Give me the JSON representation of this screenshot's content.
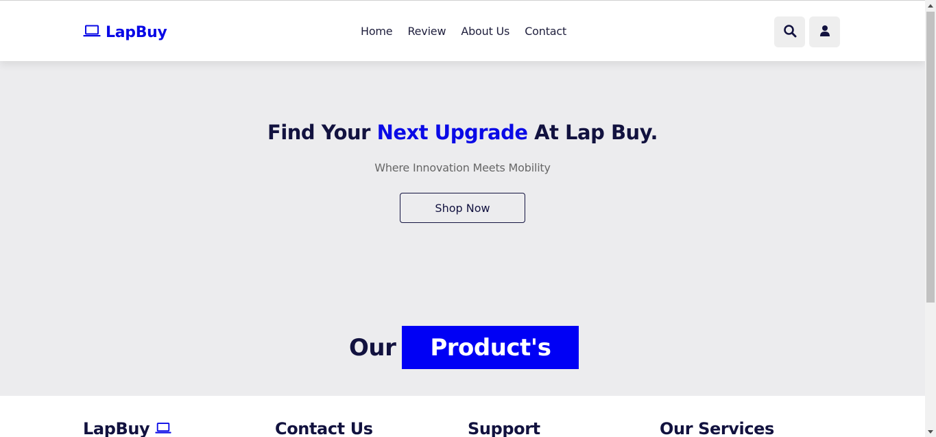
{
  "header": {
    "brand": "LapBuy",
    "brand_icon": "laptop-icon",
    "nav": [
      "Home",
      "Review",
      "About Us",
      "Contact"
    ],
    "search_icon": "search-icon",
    "user_icon": "user-icon"
  },
  "hero": {
    "title_pre": "Find Your ",
    "title_accent": "Next Upgrade",
    "title_post": " At Lap Buy.",
    "subtitle": "Where Innovation Meets Mobility",
    "cta": "Shop Now"
  },
  "products": {
    "heading_plain": "Our",
    "heading_box": "Product's"
  },
  "footer": {
    "columns": [
      "LapBuy",
      "Contact Us",
      "Support",
      "Our Services"
    ]
  },
  "colors": {
    "accent": "#0a0ae6",
    "accent_box": "#0000f5",
    "dark_text": "#12123f",
    "hero_bg": "#ececee"
  }
}
